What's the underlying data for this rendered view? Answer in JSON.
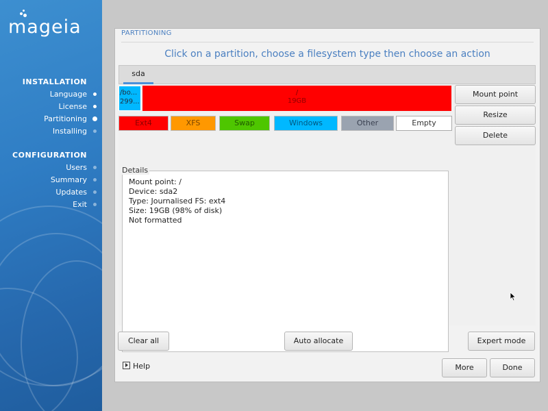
{
  "sidebar": {
    "logo": "mageia",
    "installation_title": "INSTALLATION",
    "installation_items": [
      {
        "label": "Language"
      },
      {
        "label": "License"
      },
      {
        "label": "Partitioning"
      },
      {
        "label": "Installing"
      }
    ],
    "configuration_title": "CONFIGURATION",
    "configuration_items": [
      {
        "label": "Users"
      },
      {
        "label": "Summary"
      },
      {
        "label": "Updates"
      },
      {
        "label": "Exit"
      }
    ]
  },
  "window": {
    "title": "PARTITIONING",
    "instruction": "Click on a partition, choose a filesystem type then choose an action",
    "tab_label": "sda",
    "partitions": [
      {
        "name": "/bo...",
        "size": "299..."
      },
      {
        "name": "/",
        "size": "19GB"
      }
    ],
    "legend": [
      "Ext4",
      "XFS",
      "Swap",
      "Windows",
      "Other",
      "Empty"
    ],
    "details_title": "Details",
    "details": [
      "Mount point: /",
      "Device: sda2",
      "Type: Journalised FS: ext4",
      "Size: 19GB (98% of disk)",
      "Not formatted"
    ],
    "actions": [
      "Mount point",
      "Resize",
      "Delete"
    ],
    "bottom_buttons": {
      "clear_all": "Clear all",
      "auto_allocate": "Auto allocate",
      "expert_mode": "Expert mode"
    },
    "help": "Help",
    "more": "More",
    "done": "Done"
  },
  "colors": {
    "ext4": "#ff0000",
    "xfs": "#ff9800",
    "swap": "#4ec600",
    "windows": "#00b8ff",
    "other": "#9aa3b0",
    "empty": "#ffffff",
    "accent": "#4a7fc0"
  },
  "icons": {
    "help": "help-arrow-icon",
    "cursor": "mouse-pointer-icon"
  }
}
